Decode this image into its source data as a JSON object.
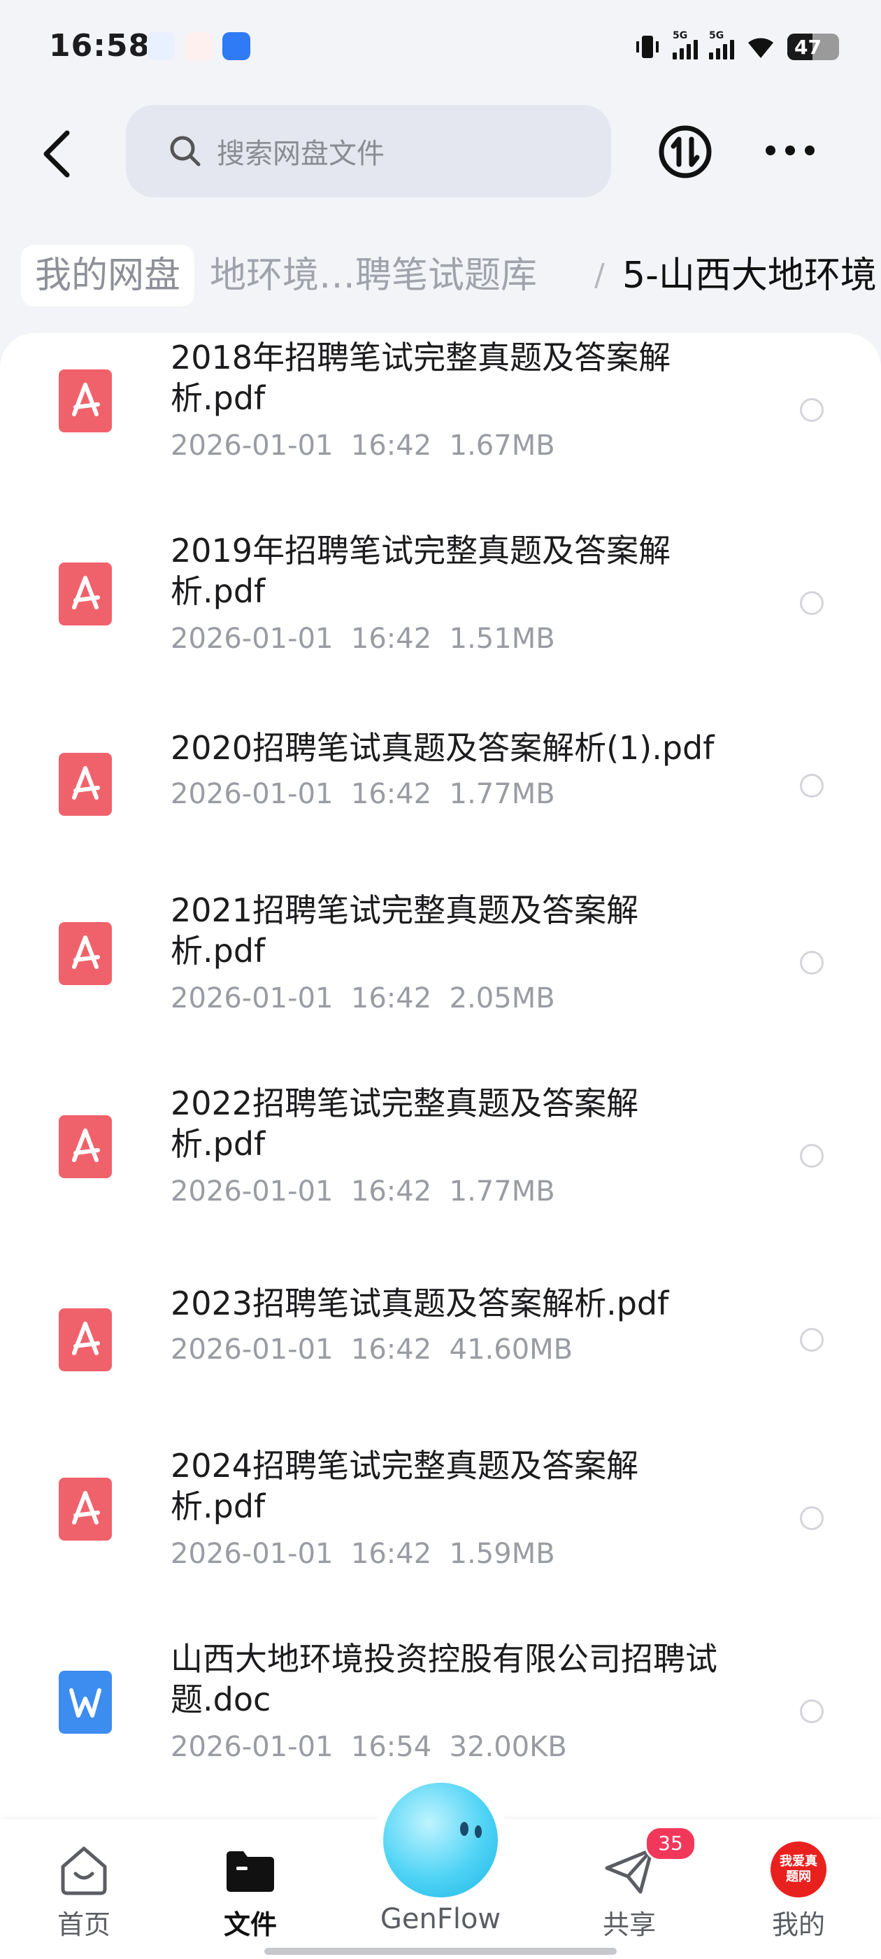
{
  "status_bar": {
    "time": "16:58",
    "network_1": "5G",
    "network_2": "5G",
    "battery": "47"
  },
  "header": {
    "search_placeholder": "搜索网盘文件"
  },
  "breadcrumb": {
    "root": "我的网盘",
    "middle": "地环境…聘笔试题库",
    "separator": "/",
    "current": "5-山西大地环境"
  },
  "files": [
    {
      "name": "2018年招聘笔试完整真题及答案解析.pdf",
      "date": "2026-01-01",
      "time": "16:42",
      "size": "1.67MB",
      "type": "pdf"
    },
    {
      "name": "2019年招聘笔试完整真题及答案解析.pdf",
      "date": "2026-01-01",
      "time": "16:42",
      "size": "1.51MB",
      "type": "pdf"
    },
    {
      "name": "2020招聘笔试真题及答案解析(1).pdf",
      "date": "2026-01-01",
      "time": "16:42",
      "size": "1.77MB",
      "type": "pdf"
    },
    {
      "name": "2021招聘笔试完整真题及答案解析.pdf",
      "date": "2026-01-01",
      "time": "16:42",
      "size": "2.05MB",
      "type": "pdf"
    },
    {
      "name": "2022招聘笔试完整真题及答案解析.pdf",
      "date": "2026-01-01",
      "time": "16:42",
      "size": "1.77MB",
      "type": "pdf"
    },
    {
      "name": "2023招聘笔试真题及答案解析.pdf",
      "date": "2026-01-01",
      "time": "16:42",
      "size": "41.60MB",
      "type": "pdf"
    },
    {
      "name": "2024招聘笔试完整真题及答案解析.pdf",
      "date": "2026-01-01",
      "time": "16:42",
      "size": "1.59MB",
      "type": "pdf"
    },
    {
      "name": "山西大地环境投资控股有限公司招聘试题.doc",
      "date": "2026-01-01",
      "time": "16:54",
      "size": "32.00KB",
      "type": "doc"
    }
  ],
  "bottom_nav": {
    "home": "首页",
    "files": "文件",
    "genflow": "GenFlow",
    "share": "共享",
    "share_badge": "35",
    "mine": "我的",
    "mine_avatar_text": "我爱真题网"
  },
  "colors": {
    "pdf_icon": "#f0626b",
    "doc_icon": "#3d8cf0",
    "accent_badge": "#f2385a"
  }
}
